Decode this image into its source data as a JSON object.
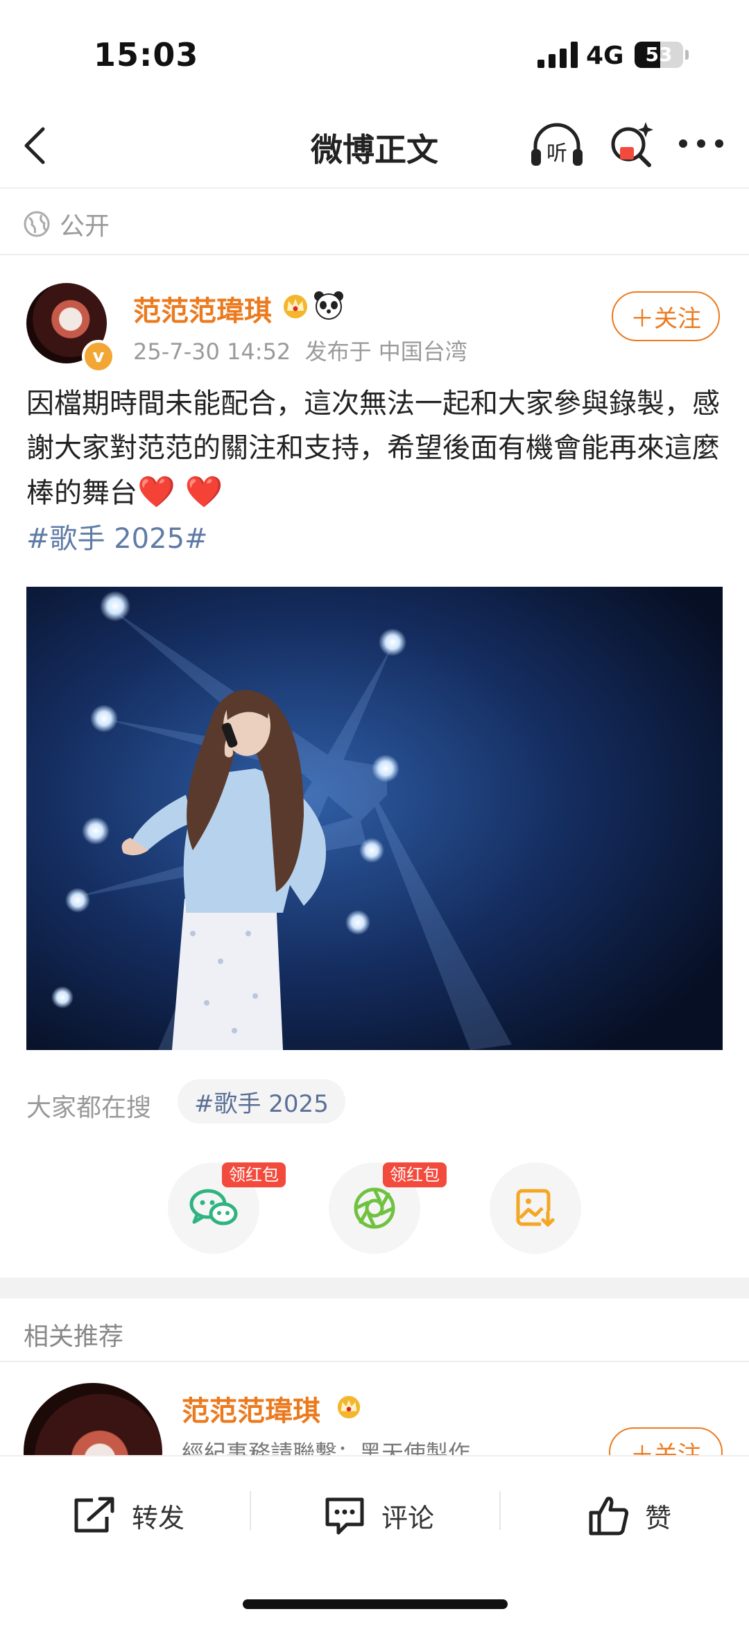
{
  "status_bar": {
    "time": "15:03",
    "network": "4G",
    "battery": 53
  },
  "nav": {
    "title": "微博正文"
  },
  "visibility": {
    "label": "公开"
  },
  "post": {
    "author": "范范范瑋琪",
    "meta": "25-7-30 14:52  发布于 中国台湾",
    "follow_label": "＋关注",
    "text": "因檔期時間未能配合，這次無法一起和大家參與錄製，感謝大家對范范的關注和支持，希望後面有機會能再來這麼棒的舞台",
    "hearts": "❤️ ❤️",
    "hashtag": "#歌手 2025#"
  },
  "search": {
    "label": "大家都在搜",
    "tag": "#歌手 2025"
  },
  "share": {
    "badge": "领红包"
  },
  "related": {
    "title": "相关推荐",
    "name": "范范范瑋琪",
    "desc": "經紀事務請聯繫：黑天使製作",
    "follow_label": "＋关注"
  },
  "actions": {
    "repost": "转发",
    "comment": "评论",
    "like": "赞"
  },
  "colors": {
    "accent": "#eb7a1f",
    "link": "#5f7ba6",
    "redpack": "#f24a3c",
    "wechat": "#2db47f"
  }
}
